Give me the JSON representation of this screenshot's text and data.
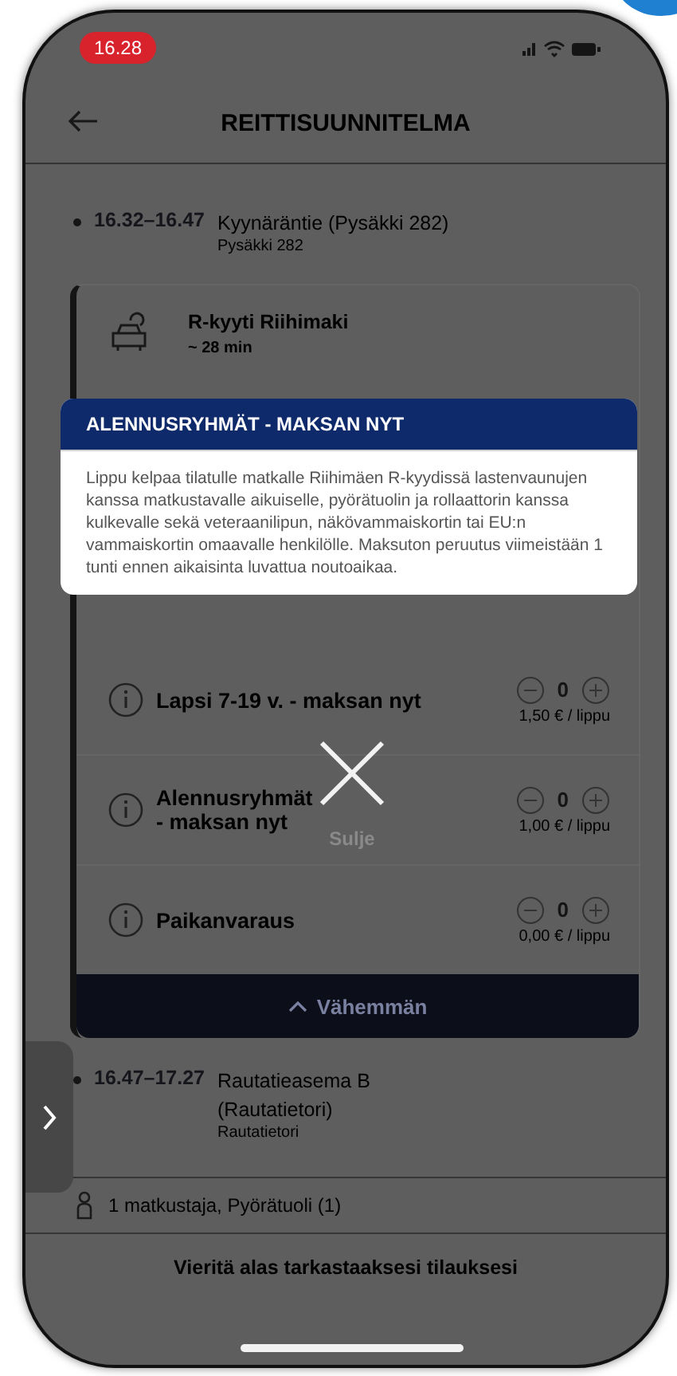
{
  "status_bar": {
    "time": "16.28"
  },
  "header": {
    "title": "REITTISUUNNITELMA"
  },
  "first_stop": {
    "time": "16.32–16.47",
    "name": "Kyynäräntie (Pysäkki 282)",
    "detail": "Pysäkki 282"
  },
  "leg": {
    "title": "R-kyyti Riihimaki",
    "duration": "~ 28 min",
    "tickets": [
      {
        "label": "Lapsi 7-19 v. - maksan nyt",
        "count": "0",
        "price": "1,50 € / lippu"
      },
      {
        "label": "Alennusryhmät - maksan nyt",
        "count": "0",
        "price": "1,00 € / lippu"
      },
      {
        "label": "Paikanvaraus",
        "count": "0",
        "price": "0,00 € / lippu"
      }
    ],
    "collapse_label": "Vähemmän"
  },
  "second_stop": {
    "time": "16.47–17.27",
    "name": "Rautatieasema B (Rautatietori)",
    "detail": "Rautatietori"
  },
  "passengers": "1 matkustaja, Pyörätuoli (1)",
  "footer": "Vieritä alas tarkastaaksesi tilauksesi",
  "modal": {
    "title": "ALENNUSRYHMÄT - MAKSAN NYT",
    "body": "Lippu kelpaa tilatulle matkalle Riihimäen R-kyydissä lastenvaunujen kanssa matkustavalle aikuiselle, pyörätuolin ja rollaattorin kanssa kulkevalle sekä veteraanilipun, näkövammaiskortin tai EU:n vammaiskortin omaavalle henkilölle. Maksuton peruutus viimeistään 1 tunti ennen aikaisinta luvattua noutoaikaa.",
    "close_label": "Sulje"
  }
}
